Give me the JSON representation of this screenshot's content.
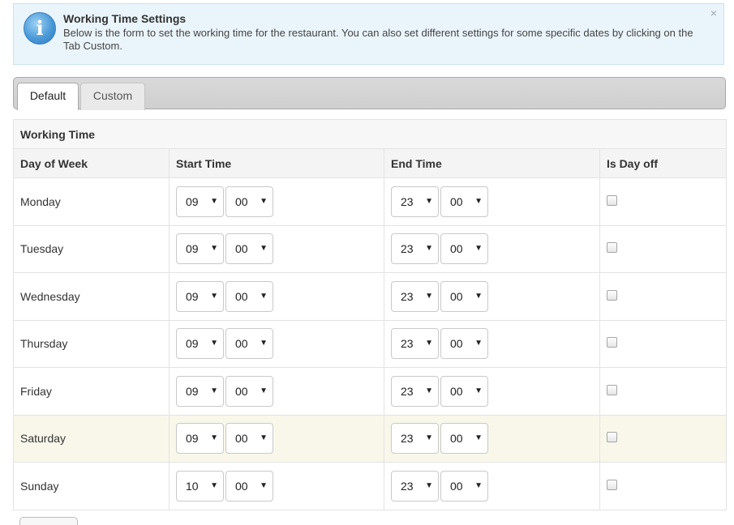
{
  "notice": {
    "title": "Working Time Settings",
    "text": "Below is the form to set the working time for the restaurant. You can also set different settings for some specific dates by clicking on the Tab Custom.",
    "close_symbol": "×",
    "icon": "info-icon",
    "icon_glyph": "i"
  },
  "tabs": [
    {
      "label": "Default",
      "active": true
    },
    {
      "label": "Custom",
      "active": false
    }
  ],
  "table": {
    "caption": "Working Time",
    "columns": [
      "Day of Week",
      "Start Time",
      "End Time",
      "Is Day off"
    ],
    "dropdown_caret": "▼",
    "rows": [
      {
        "day": "Monday",
        "start_hour": "09",
        "start_min": "00",
        "end_hour": "23",
        "end_min": "00",
        "day_off": false
      },
      {
        "day": "Tuesday",
        "start_hour": "09",
        "start_min": "00",
        "end_hour": "23",
        "end_min": "00",
        "day_off": false
      },
      {
        "day": "Wednesday",
        "start_hour": "09",
        "start_min": "00",
        "end_hour": "23",
        "end_min": "00",
        "day_off": false
      },
      {
        "day": "Thursday",
        "start_hour": "09",
        "start_min": "00",
        "end_hour": "23",
        "end_min": "00",
        "day_off": false
      },
      {
        "day": "Friday",
        "start_hour": "09",
        "start_min": "00",
        "end_hour": "23",
        "end_min": "00",
        "day_off": false
      },
      {
        "day": "Saturday",
        "start_hour": "09",
        "start_min": "00",
        "end_hour": "23",
        "end_min": "00",
        "day_off": false
      },
      {
        "day": "Sunday",
        "start_hour": "10",
        "start_min": "00",
        "end_hour": "23",
        "end_min": "00",
        "day_off": false
      }
    ]
  },
  "colors": {
    "notice_bg": "#eaf5fb",
    "highlight_row": "#f8f7ea",
    "tabbar_bg": "#d9d9d9"
  }
}
